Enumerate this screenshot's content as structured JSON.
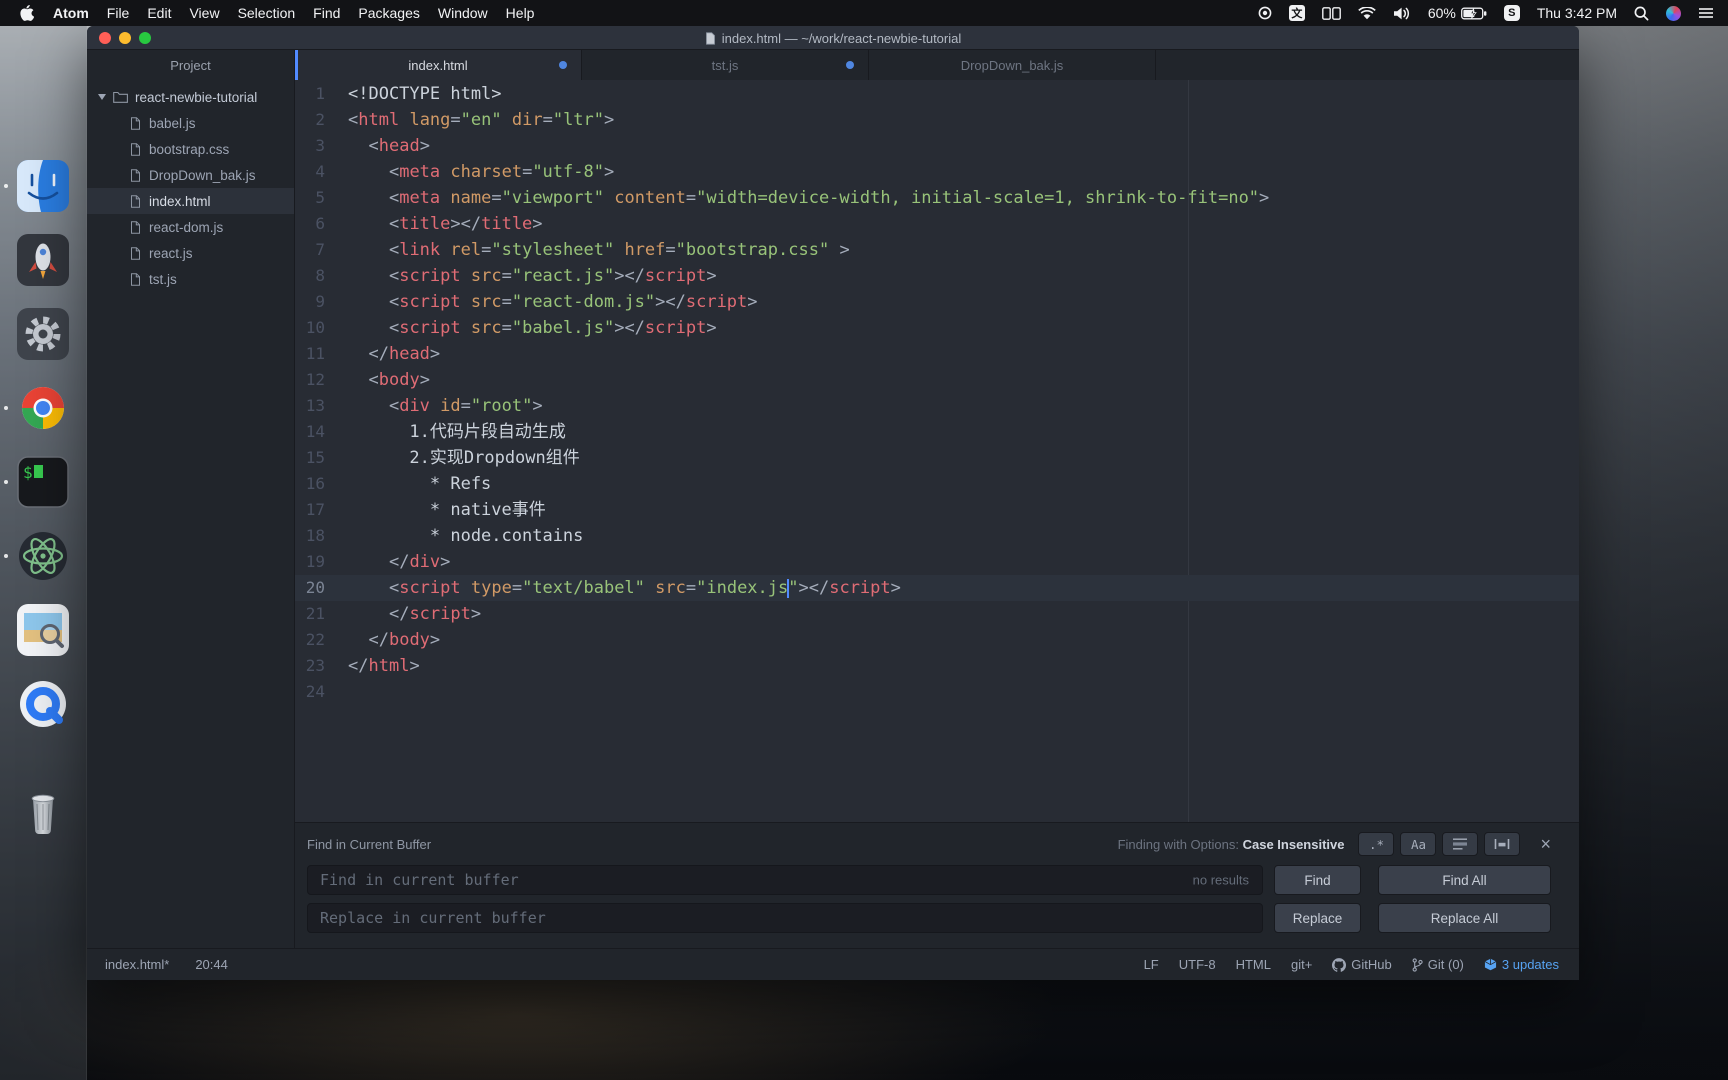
{
  "menubar": {
    "menus": [
      "Atom",
      "File",
      "Edit",
      "View",
      "Selection",
      "Find",
      "Packages",
      "Window",
      "Help"
    ],
    "input_source": "文",
    "s_app": "S",
    "battery_percent": "60%",
    "clock": "Thu 3:42 PM"
  },
  "dock": {
    "items": [
      "finder",
      "launchpad",
      "system-preferences",
      "chrome",
      "terminal",
      "atom",
      "preview",
      "quicktime",
      "trash"
    ]
  },
  "window": {
    "title": "index.html — ~/work/react-newbie-tutorial"
  },
  "tree": {
    "header": "Project",
    "root_folder": "react-newbie-tutorial",
    "files": [
      "babel.js",
      "bootstrap.css",
      "DropDown_bak.js",
      "index.html",
      "react-dom.js",
      "react.js",
      "tst.js"
    ],
    "selected": "index.html"
  },
  "tabs": [
    {
      "label": "index.html",
      "active": true,
      "modified": true
    },
    {
      "label": "tst.js",
      "active": false,
      "modified": true
    },
    {
      "label": "DropDown_bak.js",
      "active": false,
      "modified": false
    }
  ],
  "editor": {
    "active_line": 20,
    "lines": [
      [
        [
          "x",
          "<!DOCTYPE html>"
        ]
      ],
      [
        [
          "p",
          "<"
        ],
        [
          "t",
          "html"
        ],
        [
          "x",
          " "
        ],
        [
          "a",
          "lang"
        ],
        [
          "p",
          "="
        ],
        [
          "s",
          "\"en\""
        ],
        [
          "x",
          " "
        ],
        [
          "a",
          "dir"
        ],
        [
          "p",
          "="
        ],
        [
          "s",
          "\"ltr\""
        ],
        [
          "p",
          ">"
        ]
      ],
      [
        [
          "x",
          "  "
        ],
        [
          "p",
          "<"
        ],
        [
          "t",
          "head"
        ],
        [
          "p",
          ">"
        ]
      ],
      [
        [
          "x",
          "    "
        ],
        [
          "p",
          "<"
        ],
        [
          "t",
          "meta"
        ],
        [
          "x",
          " "
        ],
        [
          "a",
          "charset"
        ],
        [
          "p",
          "="
        ],
        [
          "s",
          "\"utf-8\""
        ],
        [
          "p",
          ">"
        ]
      ],
      [
        [
          "x",
          "    "
        ],
        [
          "p",
          "<"
        ],
        [
          "t",
          "meta"
        ],
        [
          "x",
          " "
        ],
        [
          "a",
          "name"
        ],
        [
          "p",
          "="
        ],
        [
          "s",
          "\"viewport\""
        ],
        [
          "x",
          " "
        ],
        [
          "a",
          "content"
        ],
        [
          "p",
          "="
        ],
        [
          "s",
          "\"width=device-width, initial-scale=1, shrink-to-fit=no\""
        ],
        [
          "p",
          ">"
        ]
      ],
      [
        [
          "x",
          "    "
        ],
        [
          "p",
          "<"
        ],
        [
          "t",
          "title"
        ],
        [
          "p",
          "></"
        ],
        [
          "t",
          "title"
        ],
        [
          "p",
          ">"
        ]
      ],
      [
        [
          "x",
          "    "
        ],
        [
          "p",
          "<"
        ],
        [
          "t",
          "link"
        ],
        [
          "x",
          " "
        ],
        [
          "a",
          "rel"
        ],
        [
          "p",
          "="
        ],
        [
          "s",
          "\"stylesheet\""
        ],
        [
          "x",
          " "
        ],
        [
          "a",
          "href"
        ],
        [
          "p",
          "="
        ],
        [
          "s",
          "\"bootstrap.css\""
        ],
        [
          "x",
          " "
        ],
        [
          "p",
          ">"
        ]
      ],
      [
        [
          "x",
          "    "
        ],
        [
          "p",
          "<"
        ],
        [
          "t",
          "script"
        ],
        [
          "x",
          " "
        ],
        [
          "a",
          "src"
        ],
        [
          "p",
          "="
        ],
        [
          "s",
          "\"react.js\""
        ],
        [
          "p",
          "></"
        ],
        [
          "t",
          "script"
        ],
        [
          "p",
          ">"
        ]
      ],
      [
        [
          "x",
          "    "
        ],
        [
          "p",
          "<"
        ],
        [
          "t",
          "script"
        ],
        [
          "x",
          " "
        ],
        [
          "a",
          "src"
        ],
        [
          "p",
          "="
        ],
        [
          "s",
          "\"react-dom.js\""
        ],
        [
          "p",
          "></"
        ],
        [
          "t",
          "script"
        ],
        [
          "p",
          ">"
        ]
      ],
      [
        [
          "x",
          "    "
        ],
        [
          "p",
          "<"
        ],
        [
          "t",
          "script"
        ],
        [
          "x",
          " "
        ],
        [
          "a",
          "src"
        ],
        [
          "p",
          "="
        ],
        [
          "s",
          "\"babel.js\""
        ],
        [
          "p",
          "></"
        ],
        [
          "t",
          "script"
        ],
        [
          "p",
          ">"
        ]
      ],
      [
        [
          "x",
          "  "
        ],
        [
          "p",
          "</"
        ],
        [
          "t",
          "head"
        ],
        [
          "p",
          ">"
        ]
      ],
      [
        [
          "x",
          "  "
        ],
        [
          "p",
          "<"
        ],
        [
          "t",
          "body"
        ],
        [
          "p",
          ">"
        ]
      ],
      [
        [
          "x",
          "    "
        ],
        [
          "p",
          "<"
        ],
        [
          "t",
          "div"
        ],
        [
          "x",
          " "
        ],
        [
          "a",
          "id"
        ],
        [
          "p",
          "="
        ],
        [
          "s",
          "\"root\""
        ],
        [
          "p",
          ">"
        ]
      ],
      [
        [
          "x",
          "      1.代码片段自动生成"
        ]
      ],
      [
        [
          "x",
          "      2.实现Dropdown组件"
        ]
      ],
      [
        [
          "x",
          "        * Refs"
        ]
      ],
      [
        [
          "x",
          "        * native事件"
        ]
      ],
      [
        [
          "x",
          "        * node.contains"
        ]
      ],
      [
        [
          "x",
          "    "
        ],
        [
          "p",
          "</"
        ],
        [
          "t",
          "div"
        ],
        [
          "p",
          ">"
        ]
      ],
      [
        [
          "x",
          "    "
        ],
        [
          "p",
          "<"
        ],
        [
          "t",
          "script"
        ],
        [
          "x",
          " "
        ],
        [
          "a",
          "type"
        ],
        [
          "p",
          "="
        ],
        [
          "s",
          "\"text/babel\""
        ],
        [
          "x",
          " "
        ],
        [
          "a",
          "src"
        ],
        [
          "p",
          "="
        ],
        [
          "s",
          "\"index.js"
        ],
        [
          "c",
          ""
        ],
        [
          "s",
          "\""
        ],
        [
          "p",
          "></"
        ],
        [
          "t",
          "script"
        ],
        [
          "p",
          ">"
        ]
      ],
      [
        [
          "x",
          "    "
        ],
        [
          "p",
          "</"
        ],
        [
          "t",
          "script"
        ],
        [
          "p",
          ">"
        ]
      ],
      [
        [
          "x",
          "  "
        ],
        [
          "p",
          "</"
        ],
        [
          "t",
          "body"
        ],
        [
          "p",
          ">"
        ]
      ],
      [
        [
          "p",
          "</"
        ],
        [
          "t",
          "html"
        ],
        [
          "p",
          ">"
        ]
      ],
      []
    ]
  },
  "find_panel": {
    "title": "Find in Current Buffer",
    "options_label": "Finding with Options:",
    "options_value": "Case Insensitive",
    "option_buttons": {
      "regex": ".*",
      "case": "Aa"
    },
    "find_placeholder": "Find in current buffer",
    "replace_placeholder": "Replace in current buffer",
    "results_text": "no results",
    "find_button": "Find",
    "find_all_button": "Find All",
    "replace_button": "Replace",
    "replace_all_button": "Replace All"
  },
  "status_bar": {
    "file": "index.html*",
    "cursor_position": "20:44",
    "items": [
      "LF",
      "UTF-8",
      "HTML",
      "git+"
    ],
    "github_label": "GitHub",
    "git_label": "Git (0)",
    "updates_label": "3 updates"
  },
  "colors": {
    "accent": "#528bff",
    "tab-dot": "#4f86e0",
    "update-blue": "#57a3f2",
    "tag-red": "#e06c75",
    "attr-orange": "#d19a66",
    "string-green": "#98c379",
    "punct-gray": "#a5adbb",
    "plain-text": "#ccd3dc"
  }
}
